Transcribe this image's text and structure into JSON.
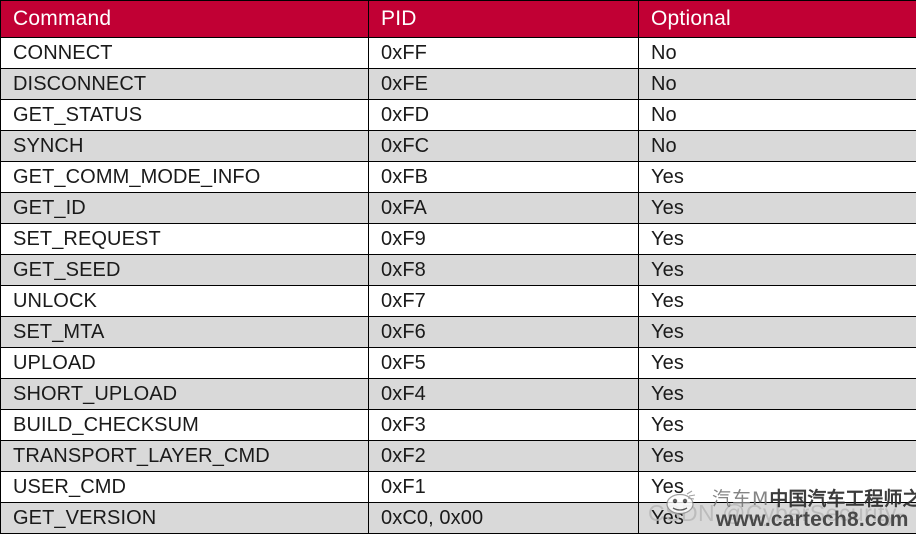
{
  "table": {
    "columns": [
      "Command",
      "PID",
      "Optional"
    ],
    "rows": [
      {
        "command": "CONNECT",
        "pid": "0xFF",
        "optional": "No"
      },
      {
        "command": "DISCONNECT",
        "pid": "0xFE",
        "optional": "No"
      },
      {
        "command": "GET_STATUS",
        "pid": "0xFD",
        "optional": "No"
      },
      {
        "command": "SYNCH",
        "pid": "0xFC",
        "optional": "No"
      },
      {
        "command": "GET_COMM_MODE_INFO",
        "pid": "0xFB",
        "optional": "Yes"
      },
      {
        "command": "GET_ID",
        "pid": "0xFA",
        "optional": "Yes"
      },
      {
        "command": "SET_REQUEST",
        "pid": "0xF9",
        "optional": "Yes"
      },
      {
        "command": "GET_SEED",
        "pid": "0xF8",
        "optional": "Yes"
      },
      {
        "command": "UNLOCK",
        "pid": "0xF7",
        "optional": "Yes"
      },
      {
        "command": "SET_MTA",
        "pid": "0xF6",
        "optional": "Yes"
      },
      {
        "command": "UPLOAD",
        "pid": "0xF5",
        "optional": "Yes"
      },
      {
        "command": "SHORT_UPLOAD",
        "pid": "0xF4",
        "optional": "Yes"
      },
      {
        "command": "BUILD_CHECKSUM",
        "pid": "0xF3",
        "optional": "Yes"
      },
      {
        "command": "TRANSPORT_LAYER_CMD",
        "pid": "0xF2",
        "optional": "Yes"
      },
      {
        "command": "USER_CMD",
        "pid": "0xF1",
        "optional": "Yes"
      },
      {
        "command": "GET_VERSION",
        "pid": "0xC0, 0x00",
        "optional": "Yes"
      }
    ]
  },
  "watermarks": {
    "csdn": "CSDN @CyberSecurity-",
    "chinese_prefix": "汽车M",
    "chinese_text": "中国汽车工程师之家",
    "url": "www.cartech8.com"
  },
  "colors": {
    "header_background": "#c10034",
    "header_text": "#ffffff",
    "row_shaded": "#d9d9d9",
    "row_plain": "#ffffff",
    "border": "#000000",
    "body_text": "#1a1a1a"
  }
}
